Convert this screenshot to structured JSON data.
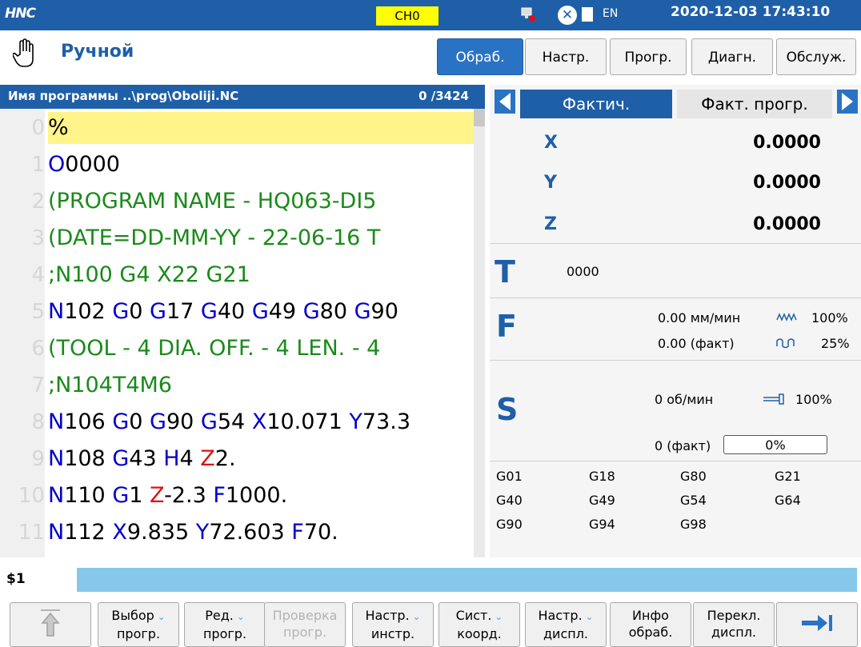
{
  "statusbar": {
    "logo": "HNC",
    "channel": "CH0",
    "lang": "EN",
    "datetime": "2020-12-03 17:43:10"
  },
  "mode": {
    "label": "Ручной",
    "tabs": [
      "Обраб.",
      "Настр.",
      "Прогр.",
      "Диагн.",
      "Обслуж."
    ],
    "active_tab": "Обраб."
  },
  "program": {
    "header_label": "Имя программы ..\\prog\\Oboliji.NC",
    "line_count": "0 /3424",
    "lines": [
      {
        "n": "0",
        "segs": [
          [
            "%",
            "k"
          ]
        ]
      },
      {
        "n": "1",
        "segs": [
          [
            "O",
            "b"
          ],
          [
            "0000",
            "k"
          ]
        ]
      },
      {
        "n": "2",
        "segs": [
          [
            "(PROGRAM NAME - HQ063-DI5",
            "g"
          ]
        ]
      },
      {
        "n": "3",
        "segs": [
          [
            "(DATE=DD-MM-YY - 22-06-16 T",
            "g"
          ]
        ]
      },
      {
        "n": "4",
        "segs": [
          [
            ";N100 G4 X22 G21",
            "g"
          ]
        ]
      },
      {
        "n": "5",
        "segs": [
          [
            "N",
            "b"
          ],
          [
            "102 ",
            "k"
          ],
          [
            "G",
            "b"
          ],
          [
            "0 ",
            "k"
          ],
          [
            "G",
            "b"
          ],
          [
            "17 ",
            "k"
          ],
          [
            "G",
            "b"
          ],
          [
            "40 ",
            "k"
          ],
          [
            "G",
            "b"
          ],
          [
            "49 ",
            "k"
          ],
          [
            "G",
            "b"
          ],
          [
            "80 ",
            "k"
          ],
          [
            "G",
            "b"
          ],
          [
            "90",
            "k"
          ]
        ]
      },
      {
        "n": "6",
        "segs": [
          [
            "(TOOL - 4 DIA. OFF. - 4 LEN. - 4",
            "g"
          ]
        ]
      },
      {
        "n": "7",
        "segs": [
          [
            ";N104T4M6",
            "g"
          ]
        ]
      },
      {
        "n": "8",
        "segs": [
          [
            "N",
            "b"
          ],
          [
            "106 ",
            "k"
          ],
          [
            "G",
            "b"
          ],
          [
            "0 ",
            "k"
          ],
          [
            "G",
            "b"
          ],
          [
            "90 ",
            "k"
          ],
          [
            "G",
            "b"
          ],
          [
            "54 ",
            "k"
          ],
          [
            "X",
            "b"
          ],
          [
            "10.071 ",
            "k"
          ],
          [
            "Y",
            "b"
          ],
          [
            "73.3",
            "k"
          ]
        ]
      },
      {
        "n": "9",
        "segs": [
          [
            "N",
            "b"
          ],
          [
            "108 ",
            "k"
          ],
          [
            "G",
            "b"
          ],
          [
            "43 ",
            "k"
          ],
          [
            "H",
            "b"
          ],
          [
            "4 ",
            "k"
          ],
          [
            "Z",
            "r"
          ],
          [
            "2.",
            "k"
          ]
        ]
      },
      {
        "n": "10",
        "segs": [
          [
            "N",
            "b"
          ],
          [
            "110 ",
            "k"
          ],
          [
            "G",
            "b"
          ],
          [
            "1 ",
            "k"
          ],
          [
            "Z",
            "r"
          ],
          [
            "-2.3 ",
            "k"
          ],
          [
            "F",
            "b"
          ],
          [
            "1000.",
            "k"
          ]
        ]
      },
      {
        "n": "11",
        "segs": [
          [
            "N",
            "b"
          ],
          [
            "112 ",
            "k"
          ],
          [
            "X",
            "b"
          ],
          [
            "9.835 ",
            "k"
          ],
          [
            "Y",
            "b"
          ],
          [
            "72.603 ",
            "k"
          ],
          [
            "F",
            "b"
          ],
          [
            "70.",
            "k"
          ]
        ]
      }
    ]
  },
  "coords": {
    "tab_active": "Фактич.",
    "tab_inactive": "Факт. прогр.",
    "axes": [
      {
        "name": "X",
        "value": "0.0000"
      },
      {
        "name": "Y",
        "value": "0.0000"
      },
      {
        "name": "Z",
        "value": "0.0000"
      }
    ]
  },
  "tool": {
    "label": "T",
    "value": "0000"
  },
  "feed": {
    "label": "F",
    "cmd": "0.00 мм/мин",
    "actual": "0.00 (факт)",
    "override_feed": "100%",
    "override_rapid": "25%"
  },
  "spindle": {
    "label": "S",
    "cmd": "0 об/мин",
    "actual": "0 (факт)",
    "override": "100%",
    "load_pct": "0%"
  },
  "gcodes": [
    [
      "G01",
      "G18",
      "G80",
      "G21"
    ],
    [
      "G40",
      "G49",
      "G54",
      "G64"
    ],
    [
      "G90",
      "G94",
      "G98",
      ""
    ]
  ],
  "command": {
    "label": "$1",
    "value": ""
  },
  "softkeys": [
    {
      "l1": "",
      "l2": "",
      "type": "up"
    },
    {
      "l1": "Выбор",
      "l2": "прогр.",
      "chev": true
    },
    {
      "l1": "Ред.",
      "l2": "прогр.",
      "chev": true
    },
    {
      "l1": "Проверка",
      "l2": "прогр.",
      "disabled": true
    },
    {
      "l1": "Настр.",
      "l2": "инстр.",
      "chev": true
    },
    {
      "l1": "Сист.",
      "l2": "коорд.",
      "chev": true
    },
    {
      "l1": "Настр.",
      "l2": "диспл.",
      "chev": true
    },
    {
      "l1": "Инфо",
      "l2": "обраб."
    },
    {
      "l1": "Перекл.",
      "l2": "диспл."
    },
    {
      "l1": "",
      "l2": "",
      "type": "next"
    }
  ],
  "colors": {
    "accent": "#1e5fa8",
    "highlight": "#fff48a",
    "command_bg": "#87c8ea"
  }
}
